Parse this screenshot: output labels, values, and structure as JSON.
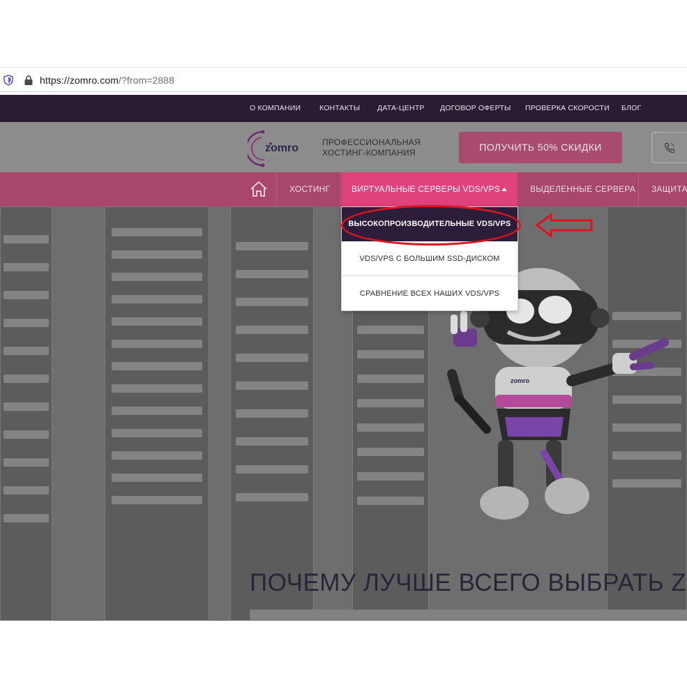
{
  "browser": {
    "url_host": "https://zomro.com",
    "url_rest": "/?from=2888"
  },
  "topnav": {
    "items": [
      "О КОМПАНИИ",
      "КОНТАКТЫ",
      "ДАТА-ЦЕНТР",
      "ДОГОВОР ОФЕРТЫ",
      "ПРОВЕРКА СКОРОСТИ",
      "БЛОГ"
    ]
  },
  "header": {
    "logo_text": "zomro",
    "tagline_line1": "ПРОФЕССИОНАЛЬНАЯ",
    "tagline_line2": "ХОСТИНГ-КОМПАНИЯ",
    "cta_label": "ПОЛУЧИТЬ 50% СКИДКИ"
  },
  "mainnav": {
    "items": [
      "ХОСТИНГ",
      "ВИРТУАЛЬНЫЕ СЕРВЕРЫ VDS/VPS",
      "ВЫДЕЛЕННЫЕ СЕРВЕРА",
      "ЗАЩИТА"
    ],
    "active_index": 1
  },
  "dropdown": {
    "items": [
      "ВЫСОКОПРОИЗВОДИТЕЛЬНЫЕ VDS/VPS",
      "VDS/VPS С БОЛЬШИМ SSD-ДИСКОМ",
      "СРАВНЕНИЕ ВСЕХ НАШИХ VDS/VPS"
    ],
    "highlighted_index": 0
  },
  "hero": {
    "title": "ПОЧЕМУ ЛУЧШЕ ВСЕГО ВЫБРАТЬ ZOM",
    "robot_badge": "zomro"
  },
  "colors": {
    "top_menu_bg": "#2a1c33",
    "main_menu_bg": "#a8466b",
    "active_tab_bg": "#e0427c",
    "dropdown_highlight_bg": "#2c1d3a",
    "annotation_red": "#e0121b"
  },
  "icons": {
    "tracking_shield": "shield-icon",
    "lock": "lock-icon",
    "phone": "phone-icon",
    "home": "home-icon",
    "caret": "caret-up-icon",
    "annotation_arrow": "arrow-left-icon"
  }
}
